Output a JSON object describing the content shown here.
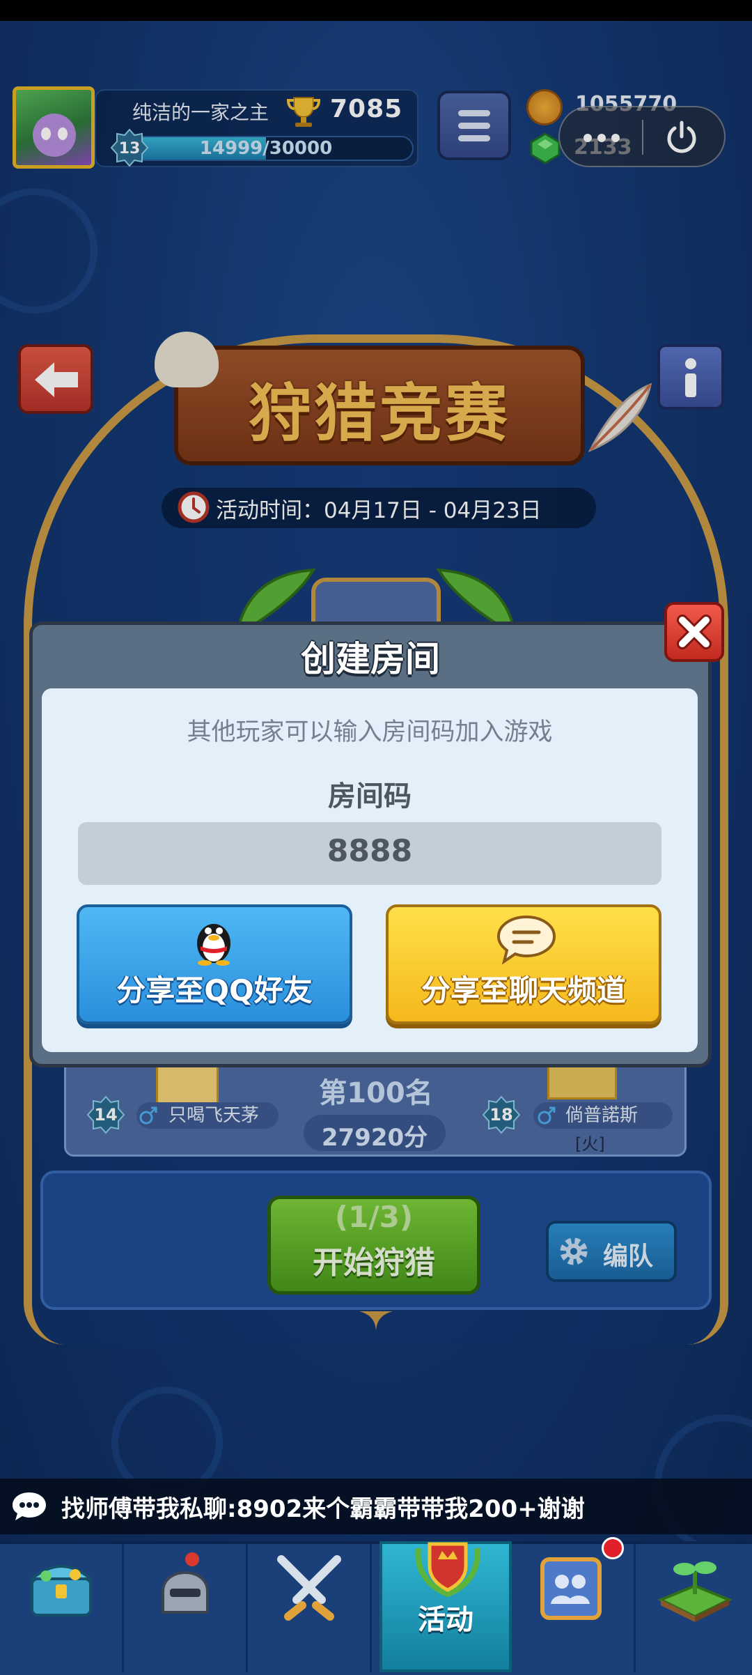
{
  "player": {
    "name": "纯洁的一家之主",
    "trophies": "7085",
    "level": "13",
    "xp_text": "14999/30000",
    "xp_progress": 0.5
  },
  "currency": {
    "coins": "1055770",
    "gems": "2133"
  },
  "event": {
    "title": "狩猎竞赛",
    "time_text": "活动时间：04月17日 - 04月23日"
  },
  "leaderboard": {
    "rank_text": "第100名",
    "score_text": "27920分",
    "left_player": {
      "level": "14",
      "name": "只喝飞天茅"
    },
    "right_player": {
      "level": "18",
      "name": "倘普諾斯",
      "tag": "[火]"
    }
  },
  "actions": {
    "hunt_count": "(1/3)",
    "hunt_label": "开始狩猎",
    "team_label": "编队"
  },
  "dialog": {
    "title": "创建房间",
    "hint": "其他玩家可以输入房间码加入游戏",
    "code_label": "房间码",
    "code_value": "8888",
    "share_qq_label": "分享至QQ好友",
    "share_chat_label": "分享至聊天频道"
  },
  "chat_ticker": {
    "message": "找师傅带我私聊:8902来个霸霸带带我200+谢谢"
  },
  "bottom_nav": {
    "active_label": "活动",
    "items": [
      "treasure-chest",
      "knight-helmet",
      "crossed-swords",
      "event-crest",
      "friends-card",
      "grass-sprout"
    ]
  },
  "colors": {
    "accent_gold": "#c99a45",
    "close_red": "#e0402e",
    "qq_blue": "#2a8fdc",
    "chat_yellow": "#f5b81c",
    "hunt_green": "#4a9a1c"
  }
}
